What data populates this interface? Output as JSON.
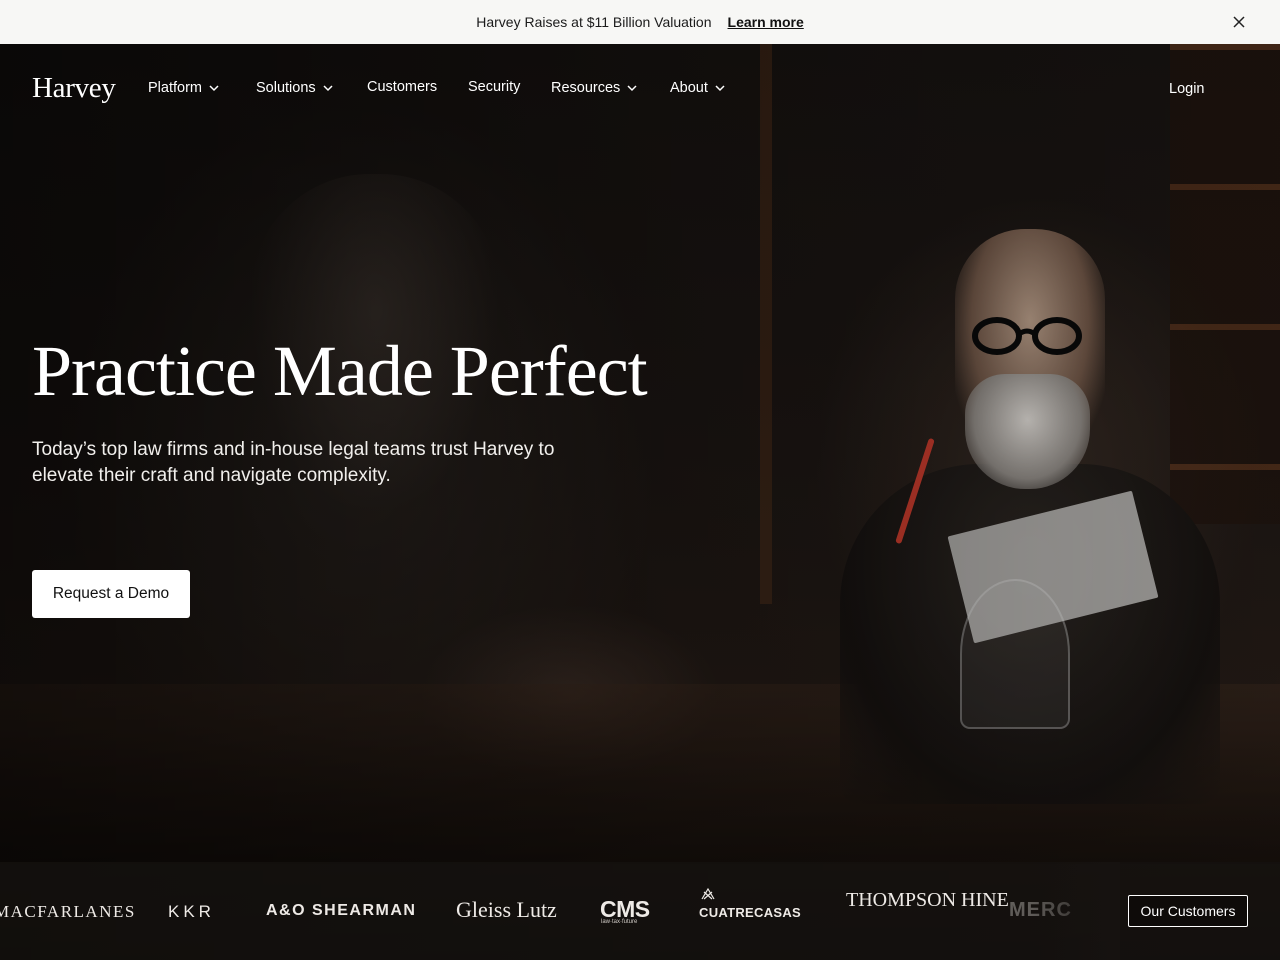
{
  "announcement": {
    "message": "Harvey Raises at $11 Billion Valuation",
    "link_label": "Learn more",
    "close_icon": "close-icon"
  },
  "nav": {
    "logo": "Harvey",
    "items": [
      {
        "label": "Platform",
        "has_dropdown": true
      },
      {
        "label": "Solutions",
        "has_dropdown": true
      },
      {
        "label": "Customers",
        "has_dropdown": false
      },
      {
        "label": "Security",
        "has_dropdown": false
      },
      {
        "label": "Resources",
        "has_dropdown": true
      },
      {
        "label": "About",
        "has_dropdown": true
      }
    ],
    "login_label": "Login"
  },
  "hero": {
    "headline": "Practice Made Perfect",
    "subhead": "Today’s top law firms and in-house legal teams trust Harvey to elevate their craft and navigate complexity.",
    "cta_label": "Request a Demo"
  },
  "customers_strip": {
    "logos": [
      "MACFARLANES",
      "KKR",
      "A&O SHEARMAN",
      "Gleiss Lutz",
      "CMS",
      "CUATRECASAS",
      "THOMPSON HINE",
      "MERC"
    ],
    "cms_tagline": "law·tax·future",
    "button_label": "Our Customers"
  },
  "colors": {
    "announcement_bg": "#f7f7f5",
    "hero_bg": "#161210",
    "cta_bg": "#ffffff",
    "text": "#ffffff"
  }
}
